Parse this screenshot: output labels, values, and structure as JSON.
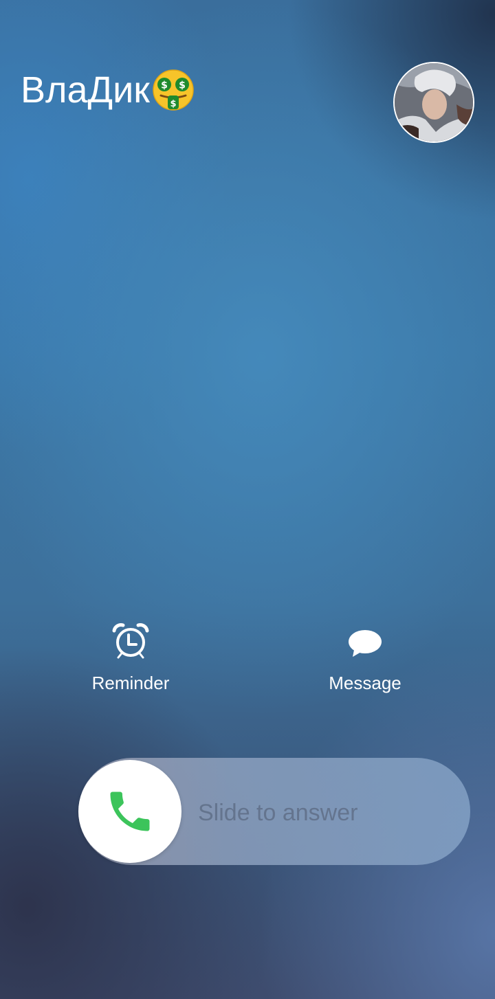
{
  "call": {
    "caller_name": "ВлаДик",
    "caller_emoji": "money-mouth-face-emoji",
    "avatar": "contact-photo"
  },
  "actions": {
    "reminder_label": "Reminder",
    "reminder_icon": "alarm-clock-icon",
    "message_label": "Message",
    "message_icon": "speech-bubble-icon"
  },
  "answer": {
    "slider_text": "Slide to answer",
    "icon": "phone-icon",
    "icon_color": "#3cc45b"
  }
}
